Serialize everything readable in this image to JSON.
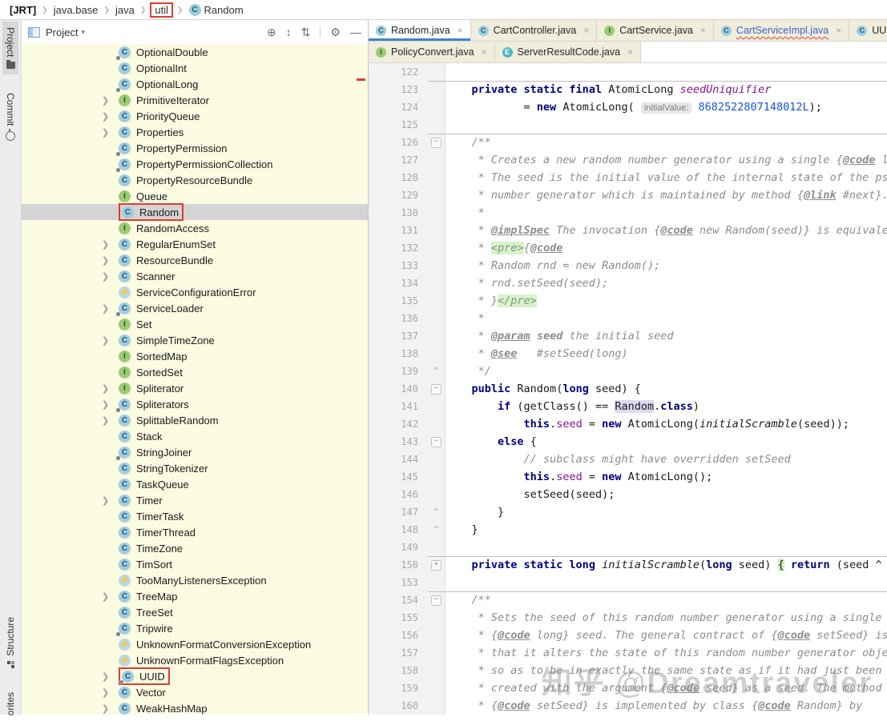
{
  "breadcrumb": {
    "items": [
      {
        "label": "[JRT]",
        "bold": true
      },
      {
        "label": "java.base"
      },
      {
        "label": "java"
      },
      {
        "label": "util",
        "annotated": true
      },
      {
        "label": "Random",
        "icon": "C"
      }
    ]
  },
  "stripe": {
    "top": [
      {
        "label": "Project",
        "icon": "folder",
        "active": true
      },
      {
        "label": "Commit",
        "icon": "commit",
        "active": false
      }
    ],
    "bottom": [
      {
        "label": "Structure",
        "icon": "structure",
        "active": false
      },
      {
        "label": "orites",
        "icon": "",
        "active": false
      }
    ]
  },
  "project_panel": {
    "title": "Project",
    "caret": "▾",
    "toolbar_icons": [
      {
        "name": "locate-icon",
        "glyph": "⊕"
      },
      {
        "name": "expand-all-icon",
        "glyph": "↕"
      },
      {
        "name": "collapse-all-icon",
        "glyph": "⇅"
      },
      {
        "name": "divider",
        "glyph": ""
      },
      {
        "name": "settings-icon",
        "glyph": "⚙"
      },
      {
        "name": "hide-icon",
        "glyph": "—"
      }
    ]
  },
  "tree": {
    "items": [
      {
        "name": "OptionalDouble",
        "icon": "C",
        "locked": true
      },
      {
        "name": "OptionalInt",
        "icon": "C"
      },
      {
        "name": "OptionalLong",
        "icon": "C",
        "locked": true
      },
      {
        "name": "PrimitiveIterator",
        "icon": "I",
        "arrow": true
      },
      {
        "name": "PriorityQueue",
        "icon": "C",
        "arrow": true
      },
      {
        "name": "Properties",
        "icon": "C",
        "arrow": true
      },
      {
        "name": "PropertyPermission",
        "icon": "C",
        "locked": true
      },
      {
        "name": "PropertyPermissionCollection",
        "icon": "C",
        "locked": true
      },
      {
        "name": "PropertyResourceBundle",
        "icon": "C"
      },
      {
        "name": "Queue",
        "icon": "I"
      },
      {
        "name": "Random",
        "icon": "C",
        "selected": true,
        "annotated": true
      },
      {
        "name": "RandomAccess",
        "icon": "I"
      },
      {
        "name": "RegularEnumSet",
        "icon": "C",
        "arrow": true
      },
      {
        "name": "ResourceBundle",
        "icon": "C",
        "arrow": true
      },
      {
        "name": "Scanner",
        "icon": "C",
        "arrow": true
      },
      {
        "name": "ServiceConfigurationError",
        "icon": "X"
      },
      {
        "name": "ServiceLoader",
        "icon": "C",
        "arrow": true,
        "locked": true
      },
      {
        "name": "Set",
        "icon": "I"
      },
      {
        "name": "SimpleTimeZone",
        "icon": "C",
        "arrow": true
      },
      {
        "name": "SortedMap",
        "icon": "I"
      },
      {
        "name": "SortedSet",
        "icon": "I"
      },
      {
        "name": "Spliterator",
        "icon": "I",
        "arrow": true
      },
      {
        "name": "Spliterators",
        "icon": "C",
        "arrow": true,
        "locked": true
      },
      {
        "name": "SplittableRandom",
        "icon": "C",
        "arrow": true
      },
      {
        "name": "Stack",
        "icon": "C"
      },
      {
        "name": "StringJoiner",
        "icon": "C",
        "locked": true
      },
      {
        "name": "StringTokenizer",
        "icon": "C"
      },
      {
        "name": "TaskQueue",
        "icon": "C"
      },
      {
        "name": "Timer",
        "icon": "C",
        "arrow": true
      },
      {
        "name": "TimerTask",
        "icon": "C"
      },
      {
        "name": "TimerThread",
        "icon": "C"
      },
      {
        "name": "TimeZone",
        "icon": "C"
      },
      {
        "name": "TimSort",
        "icon": "C"
      },
      {
        "name": "TooManyListenersException",
        "icon": "X"
      },
      {
        "name": "TreeMap",
        "icon": "C",
        "arrow": true
      },
      {
        "name": "TreeSet",
        "icon": "C"
      },
      {
        "name": "Tripwire",
        "icon": "C",
        "locked": true
      },
      {
        "name": "UnknownFormatConversionException",
        "icon": "X"
      },
      {
        "name": "UnknownFormatFlagsException",
        "icon": "X"
      },
      {
        "name": "UUID",
        "icon": "C",
        "arrow": true,
        "annotated": true,
        "locked": true
      },
      {
        "name": "Vector",
        "icon": "C",
        "arrow": true
      },
      {
        "name": "WeakHashMap",
        "icon": "C",
        "arrow": true
      }
    ]
  },
  "tabs": {
    "row1": [
      {
        "label": "Random.java",
        "icon": "C",
        "active": true
      },
      {
        "label": "CartController.java",
        "icon": "C"
      },
      {
        "label": "CartService.java",
        "icon": "I"
      },
      {
        "label": "CartServiceImpl.java",
        "icon": "C",
        "error": true
      },
      {
        "label": "UUID",
        "icon": "C"
      }
    ],
    "row2": [
      {
        "label": "PolicyConvert.java",
        "icon": "I"
      },
      {
        "label": "ServerResultCode.java",
        "icon": "E"
      }
    ]
  },
  "editor": {
    "lines": [
      {
        "n": "122",
        "t": []
      },
      {
        "n": "123",
        "sep": true,
        "t": [
          [
            "pl",
            "    "
          ],
          [
            "kw",
            "private static final "
          ],
          [
            "pl",
            "AtomicLong "
          ],
          [
            "fld",
            "seedUniquifier"
          ]
        ]
      },
      {
        "n": "124",
        "t": [
          [
            "pl",
            "            = "
          ],
          [
            "kw",
            "new "
          ],
          [
            "pl",
            "AtomicLong( "
          ],
          [
            "hint",
            "initialValue:"
          ],
          [
            "pl",
            " "
          ],
          [
            "num",
            "8682522807148012L"
          ],
          [
            "pl",
            ");"
          ]
        ]
      },
      {
        "n": "125",
        "t": []
      },
      {
        "n": "126",
        "sep": true,
        "fold": "m",
        "t": [
          [
            "pl",
            "    "
          ],
          [
            "doc",
            "/**"
          ]
        ]
      },
      {
        "n": "127",
        "t": [
          [
            "pl",
            "     "
          ],
          [
            "doc",
            "* Creates a new random number generator using a single {"
          ],
          [
            "tag",
            "@code"
          ],
          [
            "doc",
            " l"
          ]
        ]
      },
      {
        "n": "128",
        "t": [
          [
            "pl",
            "     "
          ],
          [
            "doc",
            "* The seed is the initial value of the internal state of the ps"
          ]
        ]
      },
      {
        "n": "129",
        "t": [
          [
            "pl",
            "     "
          ],
          [
            "doc",
            "* number generator which is maintained by method {"
          ],
          [
            "tag",
            "@link"
          ],
          [
            "doc",
            " #next}."
          ]
        ]
      },
      {
        "n": "130",
        "t": [
          [
            "pl",
            "     "
          ],
          [
            "doc",
            "*"
          ]
        ]
      },
      {
        "n": "131",
        "t": [
          [
            "pl",
            "     "
          ],
          [
            "doc",
            "* "
          ],
          [
            "tag",
            "@implSpec"
          ],
          [
            "doc",
            " The invocation {"
          ],
          [
            "tag",
            "@code"
          ],
          [
            "doc",
            " new Random(seed)} is equivale"
          ]
        ]
      },
      {
        "n": "132",
        "t": [
          [
            "pl",
            "     "
          ],
          [
            "doc",
            "* "
          ],
          [
            "docg",
            "<pre>"
          ],
          [
            "doc",
            "{"
          ],
          [
            "tag",
            "@code"
          ]
        ]
      },
      {
        "n": "133",
        "t": [
          [
            "pl",
            "     "
          ],
          [
            "doc",
            "* Random rnd = new Random();"
          ]
        ]
      },
      {
        "n": "134",
        "t": [
          [
            "pl",
            "     "
          ],
          [
            "doc",
            "* rnd.setSeed(seed);"
          ]
        ]
      },
      {
        "n": "135",
        "t": [
          [
            "pl",
            "     "
          ],
          [
            "doc",
            "* }"
          ],
          [
            "docg",
            "</pre>"
          ]
        ]
      },
      {
        "n": "136",
        "t": [
          [
            "pl",
            "     "
          ],
          [
            "doc",
            "*"
          ]
        ]
      },
      {
        "n": "137",
        "t": [
          [
            "pl",
            "     "
          ],
          [
            "doc",
            "* "
          ],
          [
            "tag",
            "@param"
          ],
          [
            "doc",
            " "
          ],
          [
            "docb",
            "seed"
          ],
          [
            "doc",
            " the initial seed"
          ]
        ]
      },
      {
        "n": "138",
        "t": [
          [
            "pl",
            "     "
          ],
          [
            "doc",
            "* "
          ],
          [
            "tag",
            "@see"
          ],
          [
            "doc",
            "   #setSeed(long)"
          ]
        ]
      },
      {
        "n": "139",
        "fold": "e",
        "t": [
          [
            "pl",
            "     "
          ],
          [
            "doc",
            "*/"
          ]
        ]
      },
      {
        "n": "140",
        "fold": "m",
        "t": [
          [
            "pl",
            "    "
          ],
          [
            "kw",
            "public "
          ],
          [
            "pl",
            "Random("
          ],
          [
            "kw",
            "long"
          ],
          [
            "pl",
            " seed) {"
          ]
        ]
      },
      {
        "n": "141",
        "t": [
          [
            "pl",
            "        "
          ],
          [
            "kw",
            "if"
          ],
          [
            "pl",
            " (getClass() == "
          ],
          [
            "hl",
            "Random"
          ],
          [
            "pl",
            "."
          ],
          [
            "kw",
            "class"
          ],
          [
            "pl",
            ")"
          ]
        ]
      },
      {
        "n": "142",
        "t": [
          [
            "pl",
            "            "
          ],
          [
            "kw",
            "this"
          ],
          [
            "pl",
            "."
          ],
          [
            "fld2",
            "seed"
          ],
          [
            "pl",
            " = "
          ],
          [
            "kw",
            "new "
          ],
          [
            "pl",
            "AtomicLong("
          ],
          [
            "ital",
            "initialScramble"
          ],
          [
            "pl",
            "(seed));"
          ]
        ]
      },
      {
        "n": "143",
        "fold": "m",
        "t": [
          [
            "pl",
            "        "
          ],
          [
            "kw",
            "else"
          ],
          [
            "pl",
            " {"
          ]
        ]
      },
      {
        "n": "144",
        "t": [
          [
            "pl",
            "            "
          ],
          [
            "cmt",
            "// subclass might have overridden setSeed"
          ]
        ]
      },
      {
        "n": "145",
        "t": [
          [
            "pl",
            "            "
          ],
          [
            "kw",
            "this"
          ],
          [
            "pl",
            "."
          ],
          [
            "fld2",
            "seed"
          ],
          [
            "pl",
            " = "
          ],
          [
            "kw",
            "new "
          ],
          [
            "pl",
            "AtomicLong();"
          ]
        ]
      },
      {
        "n": "146",
        "t": [
          [
            "pl",
            "            "
          ],
          [
            "pl",
            "setSeed(seed);"
          ]
        ]
      },
      {
        "n": "147",
        "fold": "e",
        "t": [
          [
            "pl",
            "        }"
          ]
        ]
      },
      {
        "n": "148",
        "fold": "e",
        "t": [
          [
            "pl",
            "    }"
          ]
        ]
      },
      {
        "n": "149",
        "t": []
      },
      {
        "n": "150",
        "sep": true,
        "fold": "p",
        "t": [
          [
            "pl",
            "    "
          ],
          [
            "kw",
            "private static long "
          ],
          [
            "ital",
            "initialScramble"
          ],
          [
            "pl",
            "("
          ],
          [
            "kw",
            "long"
          ],
          [
            "pl",
            " seed) "
          ],
          [
            "foldg",
            "{"
          ],
          [
            "pl",
            " "
          ],
          [
            "kw",
            "return"
          ],
          [
            "pl",
            " (seed ^"
          ]
        ]
      },
      {
        "n": "153",
        "t": []
      },
      {
        "n": "154",
        "sep": true,
        "fold": "m",
        "t": [
          [
            "pl",
            "    "
          ],
          [
            "doc",
            "/**"
          ]
        ]
      },
      {
        "n": "155",
        "t": [
          [
            "pl",
            "     "
          ],
          [
            "doc",
            "* Sets the seed of this random number generator using a single"
          ]
        ]
      },
      {
        "n": "156",
        "t": [
          [
            "pl",
            "     "
          ],
          [
            "doc",
            "* {"
          ],
          [
            "tag",
            "@code"
          ],
          [
            "doc",
            " long} seed. The general contract of {"
          ],
          [
            "tag",
            "@code"
          ],
          [
            "doc",
            " setSeed} is"
          ]
        ]
      },
      {
        "n": "157",
        "t": [
          [
            "pl",
            "     "
          ],
          [
            "doc",
            "* that it alters the state of this random number generator obje"
          ]
        ]
      },
      {
        "n": "158",
        "t": [
          [
            "pl",
            "     "
          ],
          [
            "doc",
            "* so as to be in exactly the same state as if it had just been"
          ]
        ]
      },
      {
        "n": "159",
        "t": [
          [
            "pl",
            "     "
          ],
          [
            "doc",
            "* created with the argument {"
          ],
          [
            "tag",
            "@code"
          ],
          [
            "doc",
            " seed} as a seed. The method"
          ]
        ]
      },
      {
        "n": "160",
        "t": [
          [
            "pl",
            "     "
          ],
          [
            "doc",
            "* {"
          ],
          [
            "tag",
            "@code"
          ],
          [
            "doc",
            " setSeed} is implemented by class {"
          ],
          [
            "tag",
            "@code"
          ],
          [
            "doc",
            " Random} by"
          ]
        ]
      }
    ]
  },
  "watermark": {
    "text": "知乎 @Dreamtraveler"
  }
}
